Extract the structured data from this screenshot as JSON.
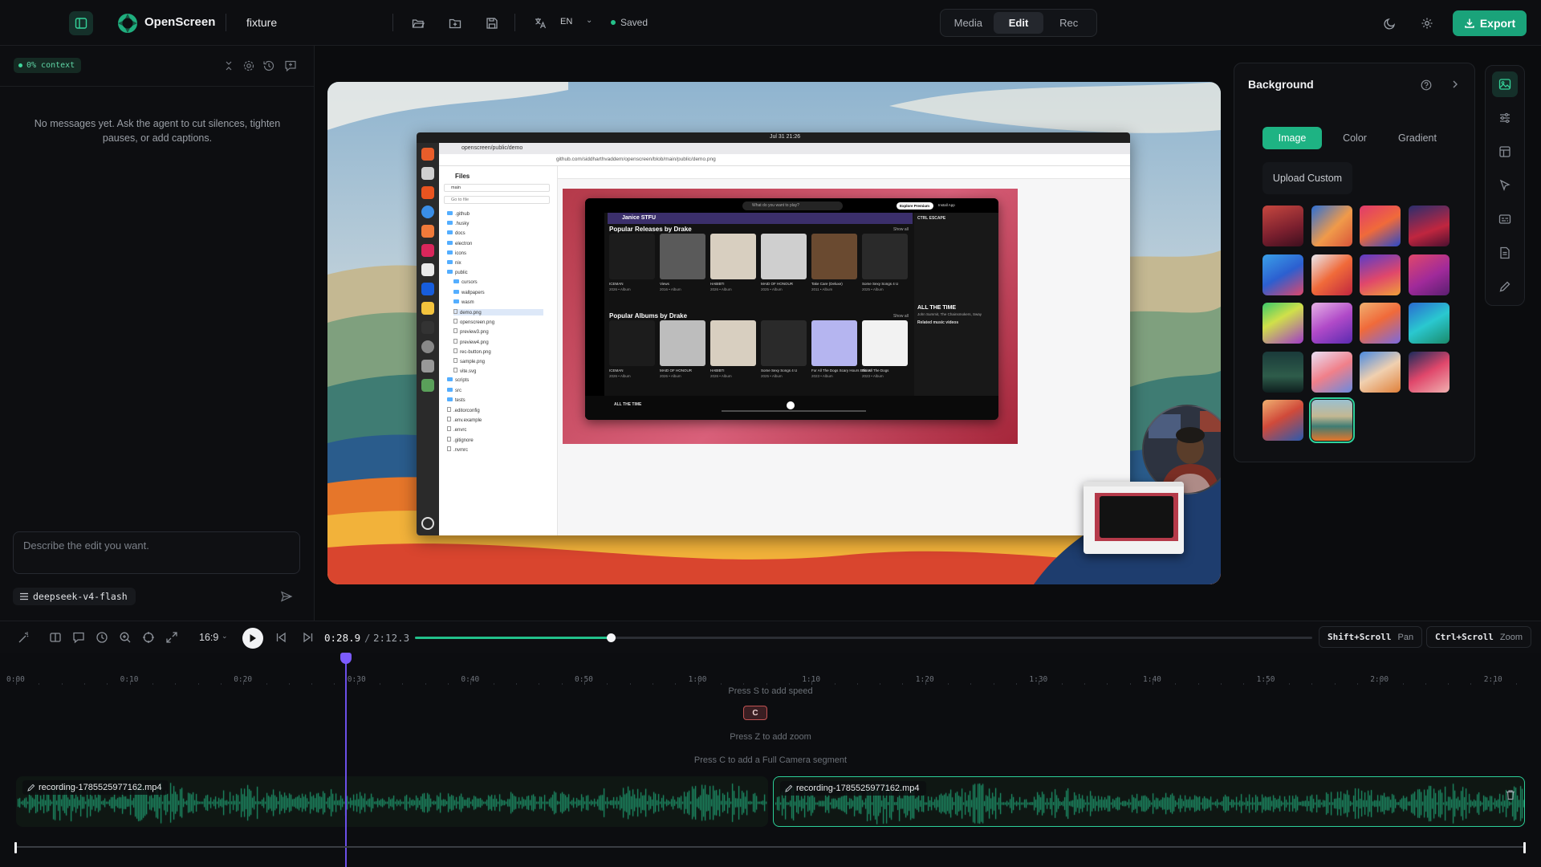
{
  "app": {
    "name": "OpenScreen",
    "project": "fixture",
    "language": "EN",
    "save_status": "Saved",
    "modes": [
      "Media",
      "Edit",
      "Rec"
    ],
    "active_mode": "Edit",
    "export_label": "Export",
    "accent": "#1aa37a"
  },
  "chat": {
    "context_badge": "0% context",
    "empty_message": "No messages yet. Ask the agent to cut silences, tighten pauses, or add captions.",
    "prompt_placeholder": "Describe the edit you want.",
    "model": "deepseek-v4-flash"
  },
  "background_panel": {
    "title": "Background",
    "tabs": [
      "Image",
      "Color",
      "Gradient"
    ],
    "active_tab": "Image",
    "upload_label": "Upload Custom",
    "swatch_count": 18,
    "selected_swatch": 17
  },
  "preview": {
    "clock": "Jul 31  21:26",
    "browser_tab": "openscreen/public/demo",
    "url": "github.com/siddharthvaddem/openscreen/blob/main/public/demo.png",
    "files_title": "Files",
    "branch": "main",
    "goto_file": "Go to file",
    "tree": [
      ".github",
      ".husky",
      "docs",
      "electron",
      "icons",
      "nix",
      "public",
      "cursors",
      "wallpapers",
      "wasm",
      "demo.png",
      "openscreen.png",
      "preview3.png",
      "preview4.png",
      "rec-button.png",
      "sample.png",
      "vite.svg",
      "scripts",
      "src",
      "tests",
      ".editorconfig",
      ".env.example",
      ".envrc",
      ".gitignore",
      ".nvmrc"
    ],
    "spotify": {
      "artist": "Janice STFU",
      "section1": "Popular Releases by Drake",
      "section2": "Popular Albums by Drake",
      "show_all": "Show all",
      "search_placeholder": "What do you want to play?",
      "explore": "Explore Premium",
      "install": "Install App",
      "now_playing_title": "ALL THE TIME",
      "now_playing_artist": "John Summit, The Chainsmokers, Sway",
      "ctrl": "CTRL ESCAPE",
      "related": "Related music videos",
      "releases": [
        {
          "title": "ICEMAN",
          "sub": "2026 • Album"
        },
        {
          "title": "Views",
          "sub": "2016 • Album"
        },
        {
          "title": "HABIBTI",
          "sub": "2026 • Album"
        },
        {
          "title": "MAID OF HONOUR",
          "sub": "2025 • Album"
        },
        {
          "title": "Take Care (Deluxe)",
          "sub": "2011 • Album"
        },
        {
          "title": "Some Sexy Songs 4 U",
          "sub": "2025 • Album"
        }
      ],
      "albums": [
        {
          "title": "ICEMAN",
          "sub": "2026 • Album"
        },
        {
          "title": "MAID OF HONOUR",
          "sub": "2026 • Album"
        },
        {
          "title": "HABIBTI",
          "sub": "2026 • Album"
        },
        {
          "title": "Some Sexy Songs 4 U",
          "sub": "2025 • Album"
        },
        {
          "title": "For All The Dogs Scary Hours Edition",
          "sub": "2023 • Album"
        },
        {
          "title": "For All The Dogs",
          "sub": "2023 • Album"
        }
      ]
    }
  },
  "transport": {
    "aspect": "16:9",
    "current_time": "0:28.9",
    "separator": "/",
    "total_time": "2:12.3",
    "progress": 0.218,
    "hints": [
      {
        "key": "Shift+Scroll",
        "action": "Pan"
      },
      {
        "key": "Ctrl+Scroll",
        "action": "Zoom"
      }
    ]
  },
  "timeline": {
    "ticks": [
      "0:00",
      "0:10",
      "0:20",
      "0:30",
      "0:40",
      "0:50",
      "1:00",
      "1:10",
      "1:20",
      "1:30",
      "1:40",
      "1:50",
      "2:00",
      "2:10"
    ],
    "hint_speed": "Press S to add speed",
    "camera_chip": "C",
    "hint_zoom": "Press Z to add zoom",
    "hint_camera": "Press C to add a Full Camera segment",
    "clips": [
      {
        "label": "recording-1785525977162.mp4"
      },
      {
        "label": "recording-1785525977162.mp4"
      }
    ]
  }
}
